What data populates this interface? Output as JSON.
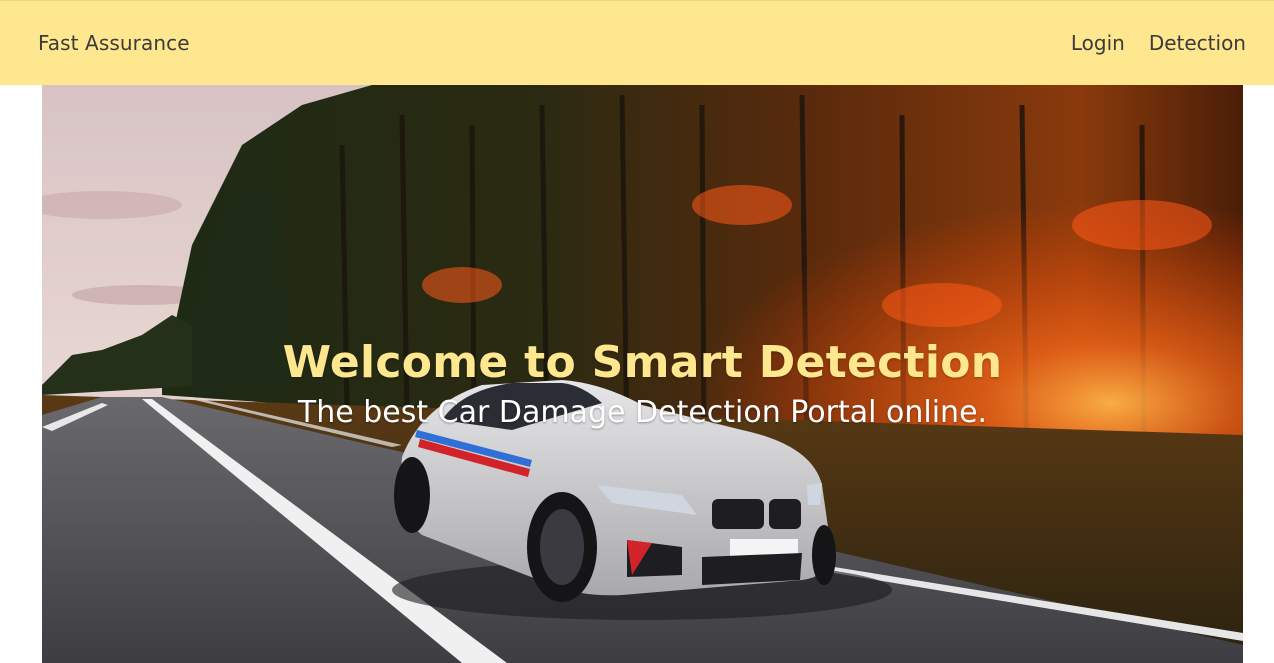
{
  "navbar": {
    "brand": "Fast Assurance",
    "links": [
      {
        "label": "Login"
      },
      {
        "label": "Detection"
      }
    ],
    "background_color": "#fee78e"
  },
  "hero": {
    "image_description_icon": "car-on-road-photo",
    "title": "Welcome to Smart Detection",
    "subtitle": "The best Car Damage Detection Portal online.",
    "title_color": "#fee78e",
    "subtitle_color": "#ffffff"
  }
}
